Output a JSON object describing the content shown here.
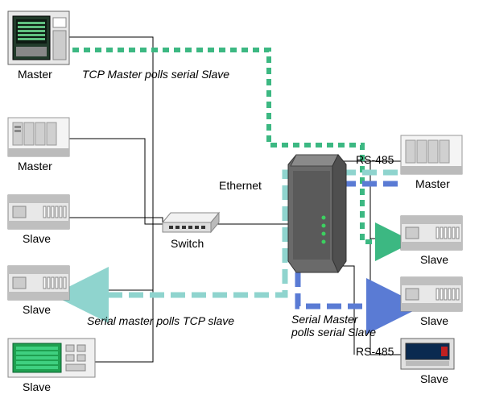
{
  "nodes": {
    "left_master1": "Master",
    "left_master2": "Master",
    "left_slave1": "Slave",
    "left_slave2": "Slave",
    "left_slave3": "Slave",
    "switch": "Switch",
    "ethernet": "Ethernet",
    "rs485_top": "RS-485",
    "rs485_bottom": "RS-485",
    "right_master": "Master",
    "right_slave1": "Slave",
    "right_slave2": "Slave",
    "right_slave3": "Slave"
  },
  "paths": {
    "tcp_master_polls_serial_slave": "TCP Master polls serial Slave",
    "serial_master_polls_tcp_slave": "Serial master polls TCP slave",
    "serial_master_polls_serial_slave_l1": "Serial Master",
    "serial_master_polls_serial_slave_l2": "polls serial Slave"
  }
}
